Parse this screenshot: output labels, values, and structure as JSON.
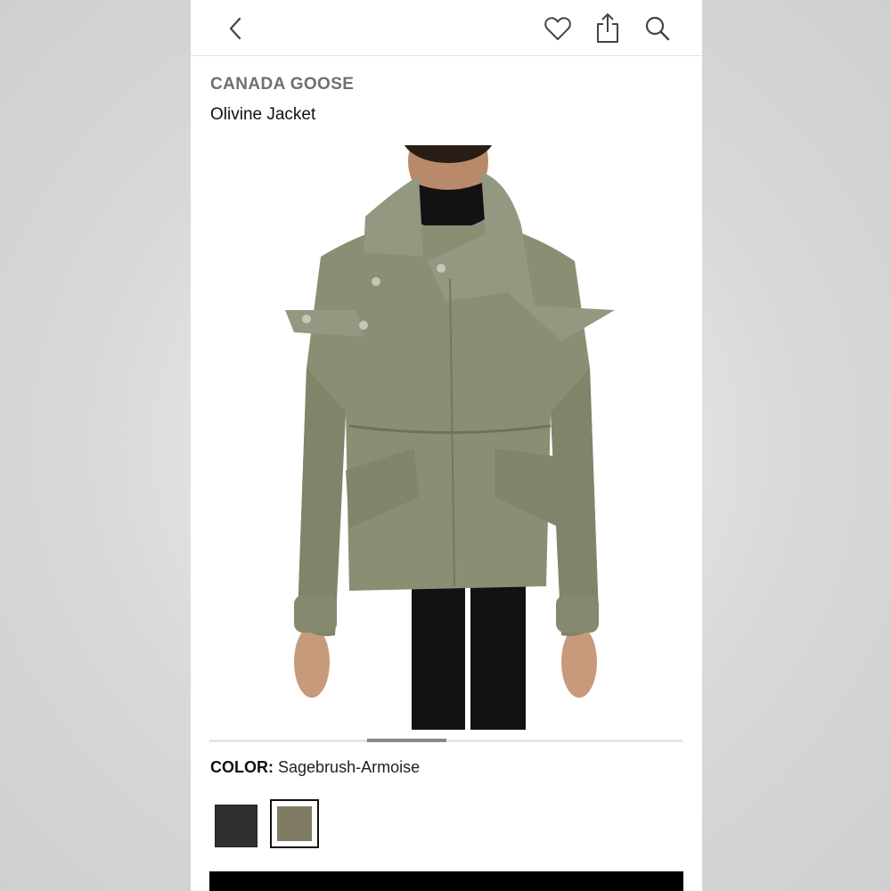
{
  "header": {
    "icons": [
      "chevron-left-icon",
      "heart-icon",
      "share-icon",
      "search-icon"
    ]
  },
  "product": {
    "brand": "CANADA GOOSE",
    "name": "Olivine Jacket"
  },
  "color": {
    "label": "COLOR:",
    "selected": "Sagebrush-Armoise",
    "swatches": [
      {
        "name": "black",
        "hex": "#2f3131",
        "selected": false
      },
      {
        "name": "Sagebrush-Armoise",
        "hex": "#807b63",
        "selected": true
      }
    ]
  },
  "carousel": {
    "current_page": 2
  },
  "colors": {
    "jacket": "#8a8f74",
    "accent": "#000000"
  }
}
